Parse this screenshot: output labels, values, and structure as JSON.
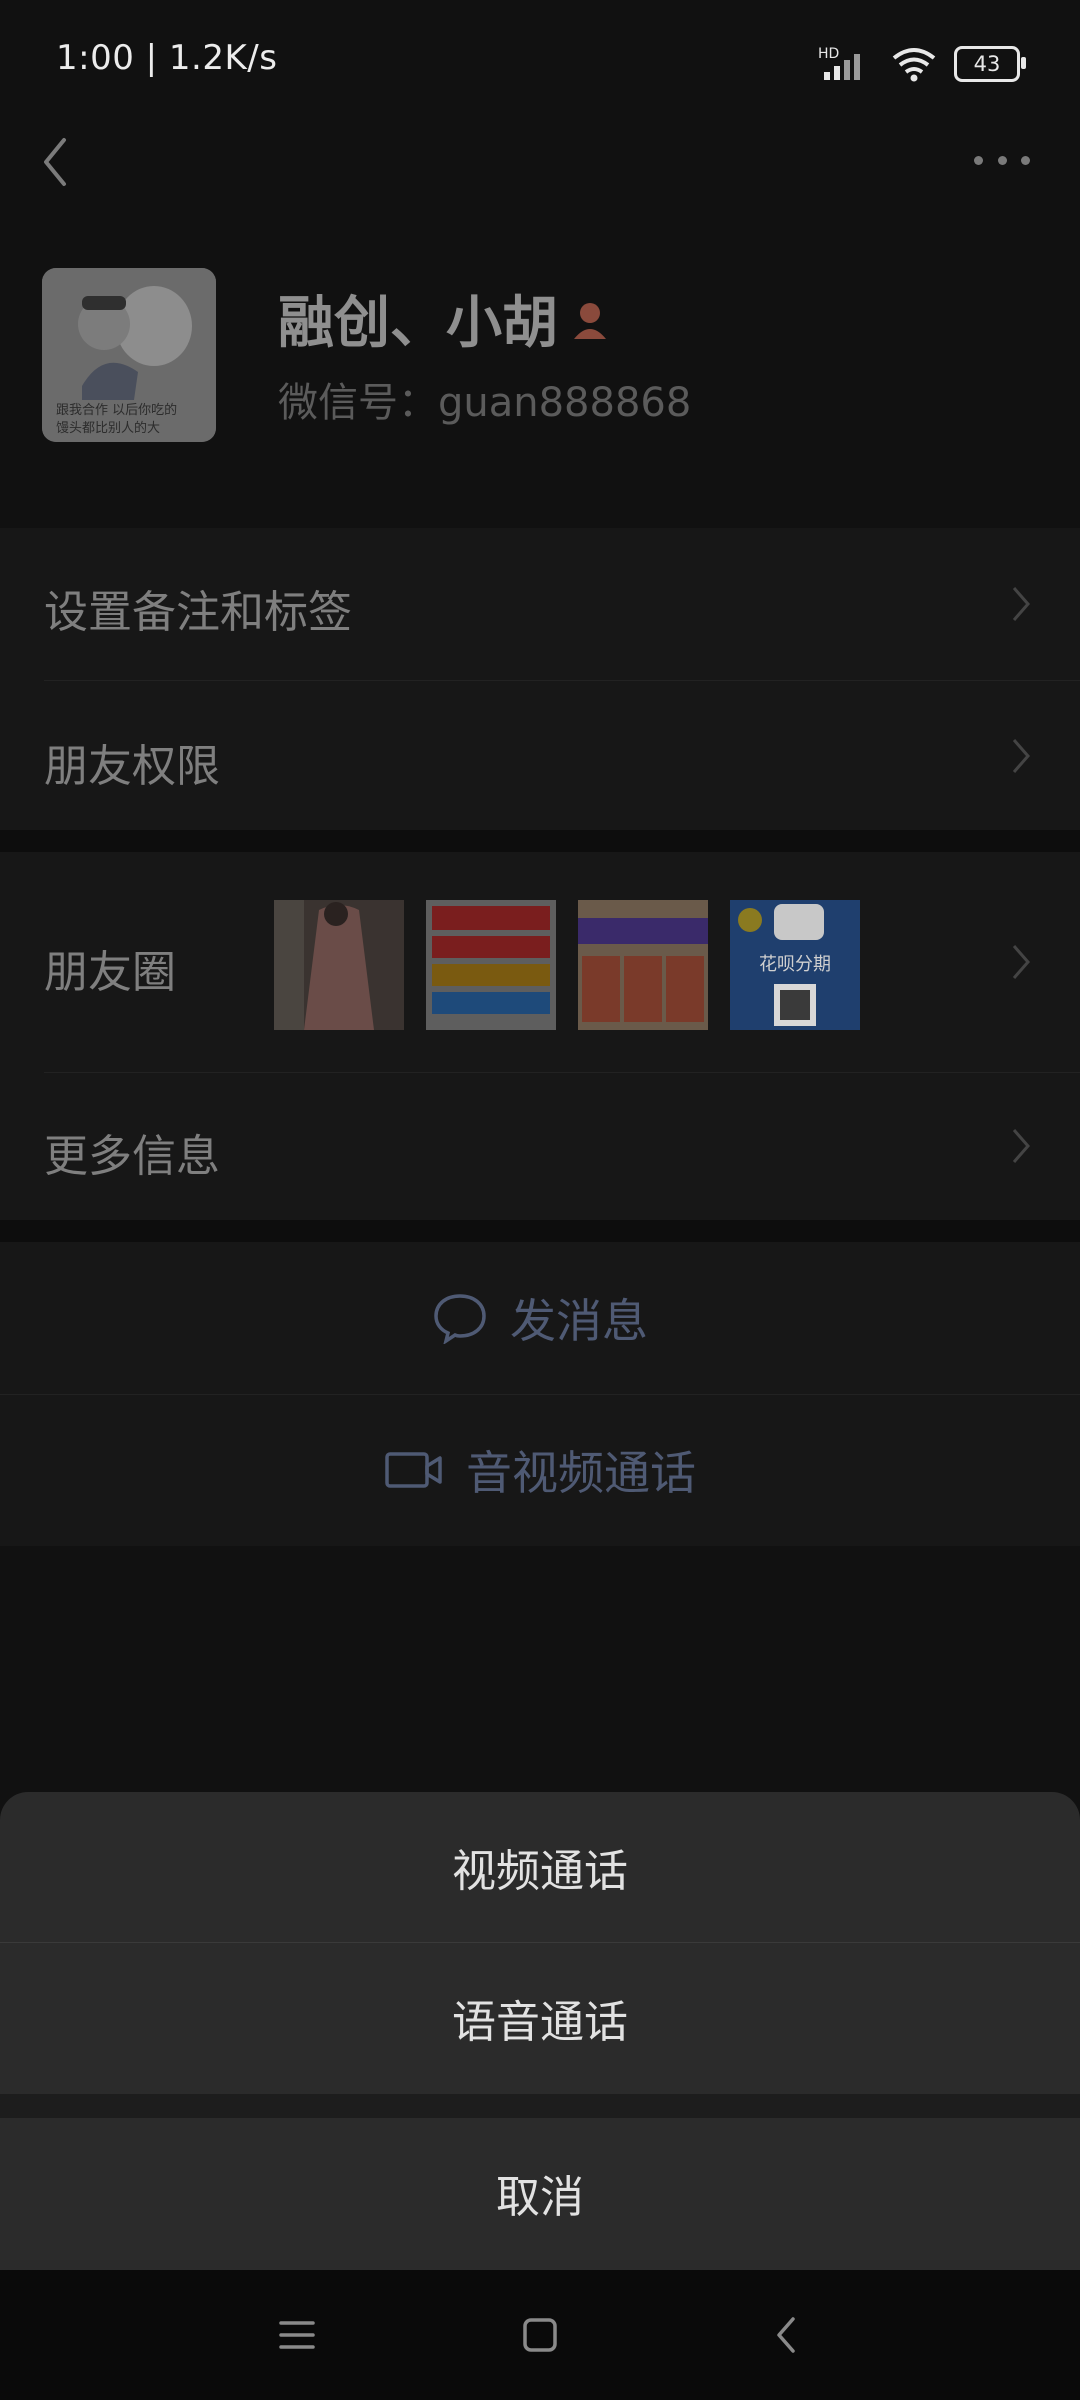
{
  "status_bar": {
    "time": "1:00 | 1.2K/s",
    "network_label": "HD",
    "battery": "43"
  },
  "header": {
    "back_icon": "chevron-left-icon",
    "more_icon": "more-dots-icon"
  },
  "profile": {
    "name": "融创、小胡",
    "wechat_id": "微信号：guan888868",
    "avatar_caption_line1": "跟我合作 以后你吃的",
    "avatar_caption_line2": "馒头都比别人的大"
  },
  "menu": {
    "remark_tags": "设置备注和标签",
    "friend_permissions": "朋友权限",
    "moments": "朋友圈",
    "more_info": "更多信息"
  },
  "moments_thumbs": [
    {
      "name": "moments-photo-1",
      "caption": ""
    },
    {
      "name": "moments-photo-2",
      "caption": ""
    },
    {
      "name": "moments-photo-3",
      "caption": ""
    },
    {
      "name": "moments-photo-4",
      "caption": "花呗分期"
    }
  ],
  "actions": {
    "send_message": "发消息",
    "av_call": "音视频通话"
  },
  "sheet": {
    "video_call": "视频通话",
    "voice_call": "语音通话",
    "cancel": "取消"
  },
  "colors": {
    "sheet_bg": "#2b2b2b",
    "action_text": "#4f5a74",
    "page_bg": "#111111"
  }
}
